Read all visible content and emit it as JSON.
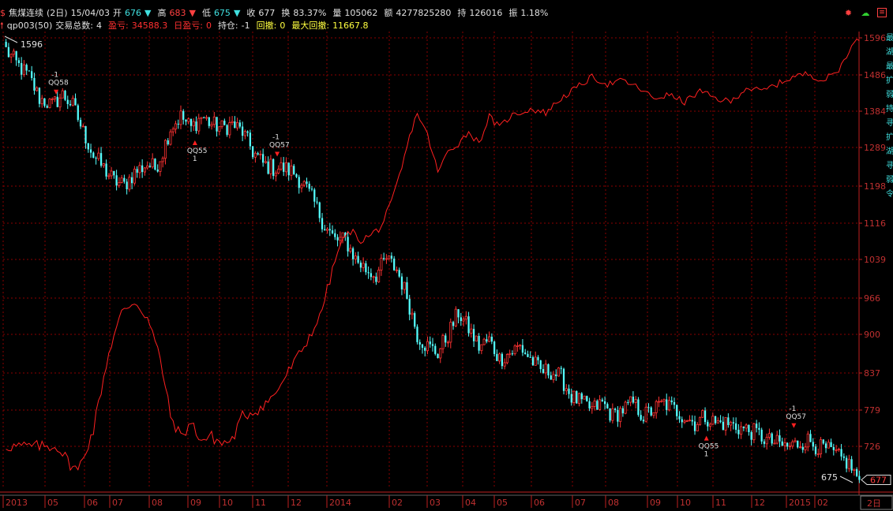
{
  "header": {
    "line1": {
      "symbol_icon": "dollar-icon",
      "symbol": "焦煤连续",
      "period": "(2日)",
      "date": "15/04/03",
      "open_label": "开",
      "open": "676",
      "high_label": "高",
      "high": "683",
      "low_label": "低",
      "low": "675",
      "close_label": "收",
      "close": "677",
      "turnover_label": "换",
      "turnover": "83.37%",
      "volume_label": "量",
      "volume": "105062",
      "amount_label": "额",
      "amount": "4277825280",
      "oi_label": "持",
      "oi": "126016",
      "amp_label": "振",
      "amp": "1.18%"
    },
    "line2": {
      "indicator": "qp003(50)",
      "trades_label": "交易总数:",
      "trades": "4",
      "pnl_label": "盈亏:",
      "pnl": "34588.3",
      "day_pnl_label": "日盈亏:",
      "day_pnl": "0",
      "pos_label": "持仓:",
      "pos": "-1",
      "dd_label": "回撤:",
      "dd": "0",
      "maxdd_label": "最大回撤:",
      "maxdd": "11667.8"
    }
  },
  "colors": {
    "up": "#ff3232",
    "down": "#54ffff",
    "equity": "#ff2020",
    "grid": "#8b0000",
    "axis_text": "#c03030",
    "bg": "#000000"
  },
  "right_strip": [
    "最",
    "湖",
    "最",
    "扩",
    "弱",
    "持",
    "寻",
    "扩",
    "湖",
    "寻",
    "弱",
    "令"
  ],
  "chart_data": {
    "type": "candlestick",
    "y_ticks": [
      "1596",
      "1486",
      "1384",
      "1289",
      "1198",
      "1116",
      "1039",
      "966",
      "900",
      "837",
      "779",
      "726"
    ],
    "x_ticks": [
      "2013",
      "05",
      "06",
      "07",
      "08",
      "09",
      "10",
      "11",
      "12",
      "2014",
      "02",
      "03",
      "04",
      "05",
      "06",
      "07",
      "08",
      "09",
      "10",
      "11",
      "12",
      "2015",
      "02",
      "03"
    ],
    "period_label": "2日",
    "last_price_tag": "677",
    "high_mark": "1596",
    "low_mark": "675",
    "ylim": [
      690,
      1620
    ],
    "anchors": [
      [
        0,
        1560
      ],
      [
        4,
        1520
      ],
      [
        9,
        1480
      ],
      [
        13,
        1420
      ],
      [
        18,
        1400
      ],
      [
        22,
        1430
      ],
      [
        26,
        1400
      ],
      [
        30,
        1330
      ],
      [
        34,
        1270
      ],
      [
        38,
        1240
      ],
      [
        42,
        1210
      ],
      [
        46,
        1200
      ],
      [
        50,
        1230
      ],
      [
        55,
        1250
      ],
      [
        58,
        1240
      ],
      [
        61,
        1280
      ],
      [
        64,
        1340
      ],
      [
        68,
        1370
      ],
      [
        72,
        1340
      ],
      [
        76,
        1370
      ],
      [
        80,
        1350
      ],
      [
        84,
        1340
      ],
      [
        88,
        1350
      ],
      [
        92,
        1330
      ],
      [
        96,
        1280
      ],
      [
        100,
        1250
      ],
      [
        104,
        1240
      ],
      [
        108,
        1240
      ],
      [
        112,
        1230
      ],
      [
        116,
        1200
      ],
      [
        120,
        1160
      ],
      [
        124,
        1110
      ],
      [
        128,
        1080
      ],
      [
        132,
        1080
      ],
      [
        136,
        1040
      ],
      [
        140,
        1020
      ],
      [
        144,
        1010
      ],
      [
        148,
        1040
      ],
      [
        152,
        1020
      ],
      [
        156,
        970
      ],
      [
        160,
        900
      ],
      [
        164,
        880
      ],
      [
        168,
        870
      ],
      [
        172,
        900
      ],
      [
        176,
        940
      ],
      [
        180,
        910
      ],
      [
        184,
        880
      ],
      [
        188,
        890
      ],
      [
        192,
        860
      ],
      [
        196,
        870
      ],
      [
        200,
        880
      ],
      [
        204,
        860
      ],
      [
        208,
        840
      ],
      [
        212,
        840
      ],
      [
        216,
        830
      ],
      [
        220,
        800
      ],
      [
        224,
        790
      ],
      [
        228,
        780
      ],
      [
        232,
        790
      ],
      [
        236,
        770
      ],
      [
        240,
        780
      ],
      [
        244,
        790
      ],
      [
        248,
        770
      ],
      [
        252,
        780
      ],
      [
        256,
        790
      ],
      [
        260,
        780
      ],
      [
        264,
        770
      ],
      [
        268,
        760
      ],
      [
        272,
        770
      ],
      [
        276,
        760
      ],
      [
        280,
        760
      ],
      [
        284,
        755
      ],
      [
        288,
        750
      ],
      [
        292,
        745
      ],
      [
        296,
        735
      ],
      [
        300,
        730
      ],
      [
        304,
        725
      ],
      [
        308,
        730
      ],
      [
        312,
        735
      ],
      [
        316,
        725
      ],
      [
        320,
        720
      ],
      [
        324,
        710
      ],
      [
        328,
        700
      ],
      [
        332,
        677
      ]
    ],
    "equity_anchors": [
      [
        0,
        726
      ],
      [
        20,
        726
      ],
      [
        25,
        700
      ],
      [
        28,
        690
      ],
      [
        34,
        750
      ],
      [
        40,
        870
      ],
      [
        45,
        940
      ],
      [
        50,
        960
      ],
      [
        55,
        930
      ],
      [
        60,
        860
      ],
      [
        64,
        770
      ],
      [
        68,
        740
      ],
      [
        72,
        760
      ],
      [
        76,
        735
      ],
      [
        80,
        740
      ],
      [
        84,
        730
      ],
      [
        88,
        735
      ],
      [
        92,
        770
      ],
      [
        98,
        780
      ],
      [
        104,
        800
      ],
      [
        110,
        840
      ],
      [
        116,
        880
      ],
      [
        122,
        930
      ],
      [
        126,
        1000
      ],
      [
        130,
        1070
      ],
      [
        134,
        1100
      ],
      [
        138,
        1080
      ],
      [
        142,
        1090
      ],
      [
        146,
        1110
      ],
      [
        150,
        1160
      ],
      [
        154,
        1240
      ],
      [
        158,
        1340
      ],
      [
        160,
        1380
      ],
      [
        164,
        1320
      ],
      [
        168,
        1230
      ],
      [
        172,
        1280
      ],
      [
        176,
        1300
      ],
      [
        180,
        1330
      ],
      [
        184,
        1300
      ],
      [
        188,
        1370
      ],
      [
        192,
        1340
      ],
      [
        196,
        1370
      ],
      [
        200,
        1380
      ],
      [
        204,
        1390
      ],
      [
        210,
        1380
      ],
      [
        216,
        1420
      ],
      [
        222,
        1450
      ],
      [
        228,
        1480
      ],
      [
        234,
        1460
      ],
      [
        240,
        1470
      ],
      [
        246,
        1450
      ],
      [
        252,
        1420
      ],
      [
        258,
        1430
      ],
      [
        264,
        1410
      ],
      [
        270,
        1440
      ],
      [
        276,
        1420
      ],
      [
        282,
        1410
      ],
      [
        288,
        1450
      ],
      [
        294,
        1440
      ],
      [
        300,
        1460
      ],
      [
        306,
        1480
      ],
      [
        312,
        1490
      ],
      [
        318,
        1470
      ],
      [
        324,
        1500
      ],
      [
        328,
        1560
      ],
      [
        332,
        1596
      ]
    ],
    "signals": [
      {
        "i": 20,
        "text": "QQ58",
        "num": "-1",
        "dir": "short"
      },
      {
        "i": 74,
        "text": "QQ55",
        "num": "1",
        "dir": "long"
      },
      {
        "i": 106,
        "text": "QQ57",
        "num": "-1",
        "dir": "short"
      },
      {
        "i": 273,
        "text": "QQ55",
        "num": "1",
        "dir": "long"
      },
      {
        "i": 307,
        "text": "QQ57",
        "num": "-1",
        "dir": "short"
      }
    ]
  }
}
